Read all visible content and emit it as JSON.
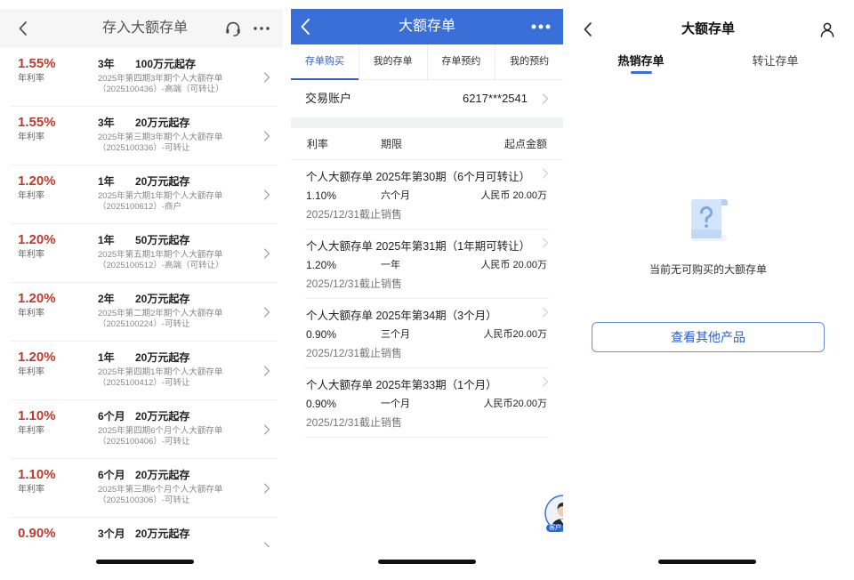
{
  "colors": {
    "rate_red": "#c0392b",
    "brand_blue": "#3a6fd8",
    "link_blue": "#2f60c8"
  },
  "left": {
    "header": {
      "title": "存入大额存单",
      "icons": [
        "chevron-left-icon",
        "headset-icon",
        "more-icon"
      ]
    },
    "items": [
      {
        "rate": "1.55%",
        "rate_label": "年利率",
        "term": "3年",
        "min_amount": "100万元起存",
        "name": "2025年第四期3年期个人大额存单",
        "code_note": "（2025100436）-高端（可转让）"
      },
      {
        "rate": "1.55%",
        "rate_label": "年利率",
        "term": "3年",
        "min_amount": "20万元起存",
        "name": "2025年第三期3年期个人大额存单",
        "code_note": "（2025100336）-可转让"
      },
      {
        "rate": "1.20%",
        "rate_label": "年利率",
        "term": "1年",
        "min_amount": "20万元起存",
        "name": "2025年第六期1年期个人大额存单",
        "code_note": "（2025100612）-商户"
      },
      {
        "rate": "1.20%",
        "rate_label": "年利率",
        "term": "1年",
        "min_amount": "50万元起存",
        "name": "2025年第五期1年期个人大额存单",
        "code_note": "（2025100512）-高端（可转让）"
      },
      {
        "rate": "1.20%",
        "rate_label": "年利率",
        "term": "2年",
        "min_amount": "20万元起存",
        "name": "2025年第二期2年期个人大额存单",
        "code_note": "（2025100224）-可转让"
      },
      {
        "rate": "1.20%",
        "rate_label": "年利率",
        "term": "1年",
        "min_amount": "20万元起存",
        "name": "2025年第四期1年期个人大额存单",
        "code_note": "（2025100412）-可转让"
      },
      {
        "rate": "1.10%",
        "rate_label": "年利率",
        "term": "6个月",
        "min_amount": "20万元起存",
        "name": "2025年第四期6个月个人大额存单",
        "code_note": "（2025100406）-可转让"
      },
      {
        "rate": "1.10%",
        "rate_label": "年利率",
        "term": "6个月",
        "min_amount": "20万元起存",
        "name": "2025年第三期6个月个人大额存单",
        "code_note": "（2025100306）-可转让"
      },
      {
        "rate": "0.90%",
        "term": "3个月",
        "min_amount": "20万元起存"
      }
    ]
  },
  "middle": {
    "header": {
      "title": "大额存单",
      "icons": [
        "chevron-left-icon",
        "more-icon"
      ]
    },
    "tabs": [
      {
        "label": "存单购买"
      },
      {
        "label": "我的存单"
      },
      {
        "label": "存单预约"
      },
      {
        "label": "我的预约"
      }
    ],
    "active_tab": 0,
    "account": {
      "label": "交易账户",
      "value": "6217***2541"
    },
    "columns": {
      "rate": "利率",
      "term": "期限",
      "amount": "起点金额"
    },
    "items": [
      {
        "title": "个人大额存单 2025年第30期（6个月可转让）",
        "rate": "1.10%",
        "term": "六个月",
        "amount": "人民币 20.00万",
        "deadline": "2025/12/31截止销售"
      },
      {
        "title": "个人大额存单 2025年第31期（1年期可转让）",
        "rate": "1.20%",
        "term": "一年",
        "amount": "人民币 20.00万",
        "deadline": "2025/12/31截止销售"
      },
      {
        "title": "个人大额存单 2025年第34期（3个月）",
        "rate": "0.90%",
        "term": "三个月",
        "amount": "人民币20.00万",
        "deadline": "2025/12/31截止销售"
      },
      {
        "title": "个人大额存单 2025年第33期（1个月）",
        "rate": "0.90%",
        "term": "一个月",
        "amount": "人民币20.00万",
        "deadline": "2025/12/31截止销售"
      }
    ],
    "service_badge": "客户"
  },
  "right": {
    "header": {
      "title": "大额存单",
      "icons": [
        "chevron-left-icon",
        "user-icon"
      ]
    },
    "tabs": [
      {
        "label": "热销存单"
      },
      {
        "label": "转让存单"
      }
    ],
    "active_tab": 0,
    "empty_text": "当前无可购买的大额存单",
    "button_label": "查看其他产品"
  }
}
